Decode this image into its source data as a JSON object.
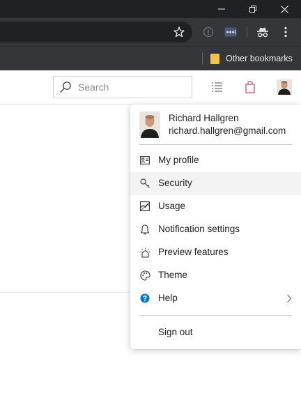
{
  "browser": {
    "bookmarks": {
      "folder_label": "Other bookmarks"
    }
  },
  "header": {
    "search": {
      "placeholder": "Search"
    }
  },
  "menu": {
    "user": {
      "name": "Richard Hallgren",
      "email": "richard.hallgren@gmail.com"
    },
    "items": [
      {
        "label": "My profile",
        "icon": "contact-card-icon"
      },
      {
        "label": "Security",
        "icon": "key-icon",
        "active": true
      },
      {
        "label": "Usage",
        "icon": "usage-icon"
      },
      {
        "label": "Notification settings",
        "icon": "bell-icon"
      },
      {
        "label": "Preview features",
        "icon": "preview-features-icon"
      },
      {
        "label": "Theme",
        "icon": "palette-icon"
      },
      {
        "label": "Help",
        "icon": "help-icon",
        "has_submenu": true
      }
    ],
    "sign_out_label": "Sign out"
  },
  "colors": {
    "chrome_titlebar": "#202124",
    "chrome_toolbar": "#35363a",
    "menu_active_bg": "#f3f3f3",
    "help_icon_blue": "#0078d4",
    "bookmark_folder": "#f6c344"
  }
}
